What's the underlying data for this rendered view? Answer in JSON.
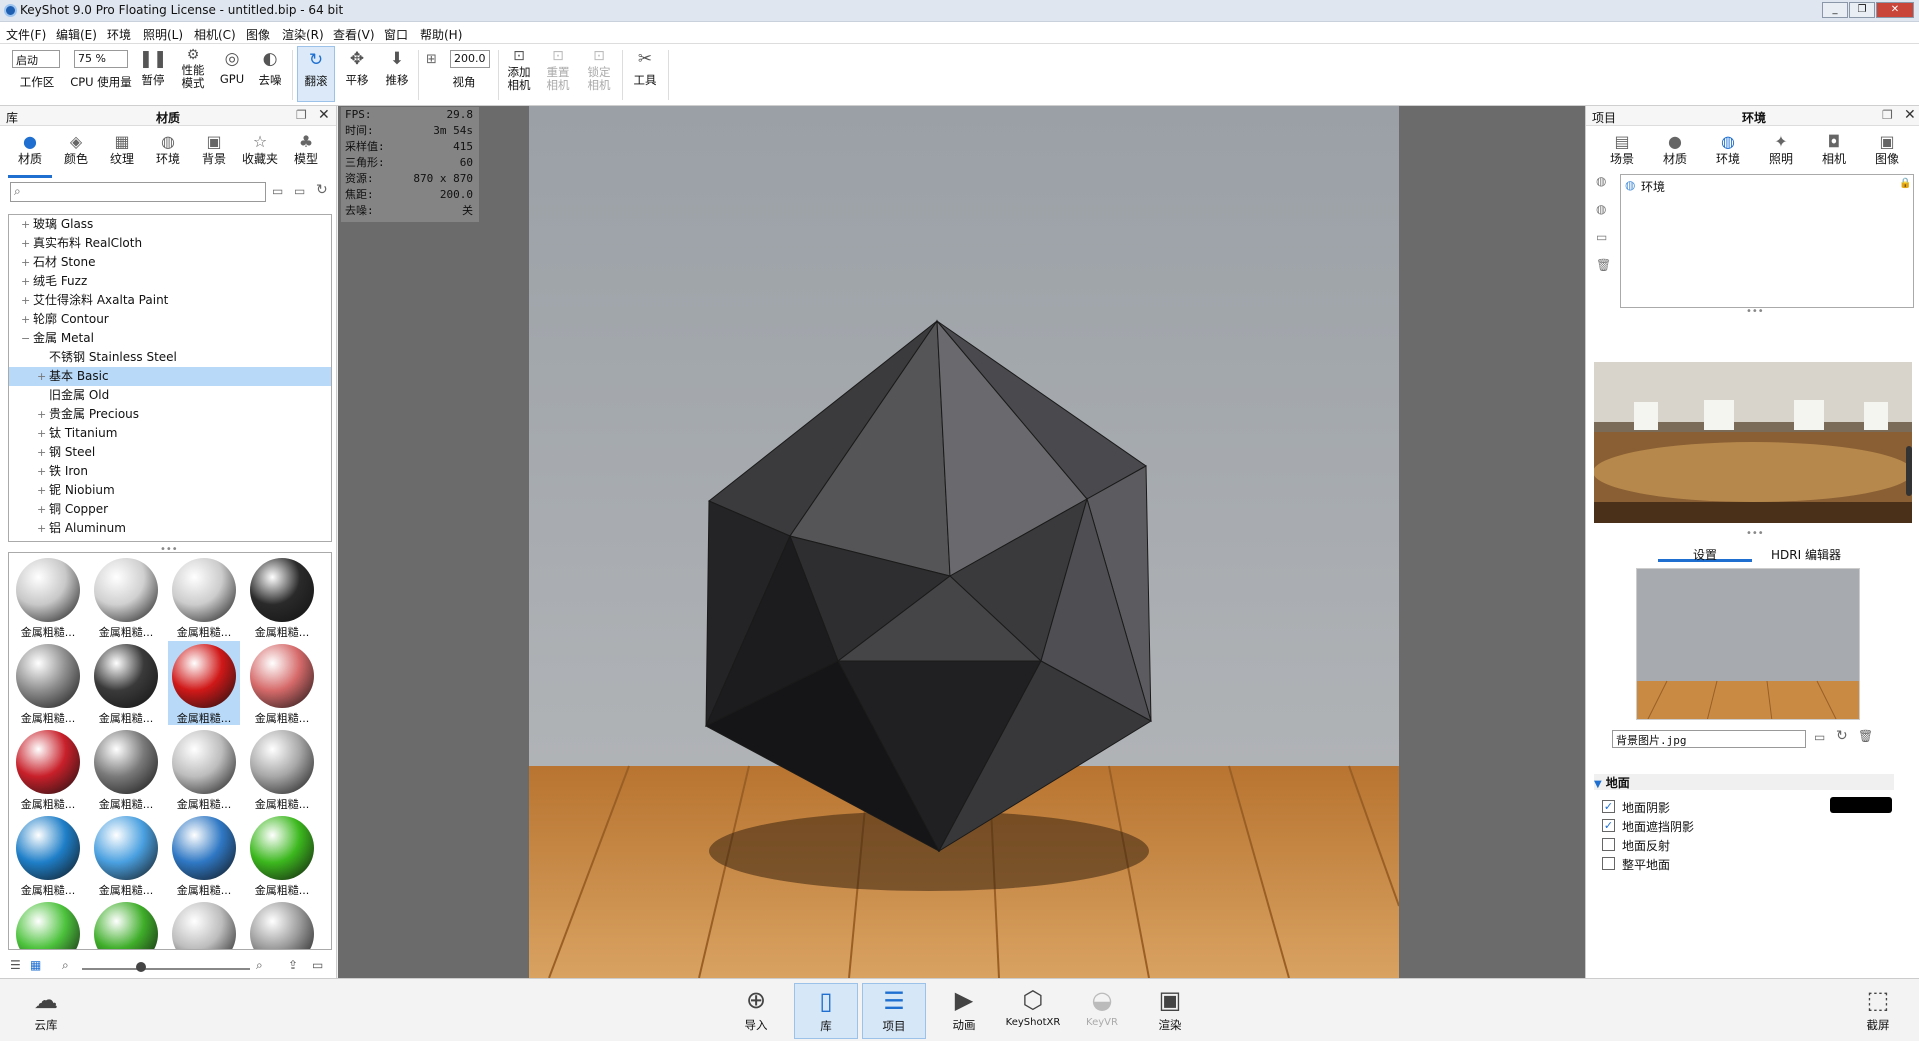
{
  "window": {
    "title": "KeyShot 9.0 Pro Floating License  - untitled.bip  - 64 bit"
  },
  "menu": [
    "文件(F)",
    "编辑(E)",
    "环境",
    "照明(L)",
    "相机(C)",
    "图像",
    "渲染(R)",
    "查看(V)",
    "窗口",
    "帮助(H)"
  ],
  "toolbar": {
    "workspace_value": "启动",
    "workspace_label": "工作区",
    "cpu_value": "75 %",
    "cpu_label": "CPU 使用量",
    "pause": "暂停",
    "perf1": "性能",
    "perf2": "模式",
    "gpu": "GPU",
    "denoise": "去噪",
    "tumble": "翻滚",
    "pan": "平移",
    "dolly": "推移",
    "fov_value": "200.0",
    "fov_label": "视角",
    "add_cam1": "添加",
    "add_cam2": "相机",
    "reset_cam1": "重置",
    "reset_cam2": "相机",
    "lock_cam1": "锁定",
    "lock_cam2": "相机",
    "tools": "工具"
  },
  "library": {
    "panel_label": "库",
    "title": "材质",
    "tabs": [
      "材质",
      "颜色",
      "纹理",
      "环境",
      "背景",
      "收藏夹",
      "模型"
    ],
    "search_placeholder": "",
    "tree": [
      {
        "exp": "+",
        "label": "玻璃 Glass",
        "indent": 0
      },
      {
        "exp": "+",
        "label": "真实布料 RealCloth",
        "indent": 0
      },
      {
        "exp": "+",
        "label": "石材 Stone",
        "indent": 0
      },
      {
        "exp": "+",
        "label": "绒毛 Fuzz",
        "indent": 0
      },
      {
        "exp": "+",
        "label": "艾仕得涂料 Axalta Paint",
        "indent": 0
      },
      {
        "exp": "+",
        "label": "轮廓 Contour",
        "indent": 0
      },
      {
        "exp": "−",
        "label": "金属 Metal",
        "indent": 0
      },
      {
        "exp": "",
        "label": "不锈钢 Stainless Steel",
        "indent": 1
      },
      {
        "exp": "+",
        "label": "基本 Basic",
        "indent": 1,
        "selected": true
      },
      {
        "exp": "",
        "label": "旧金属 Old",
        "indent": 1
      },
      {
        "exp": "+",
        "label": "贵金属 Precious",
        "indent": 1
      },
      {
        "exp": "+",
        "label": "钛 Titanium",
        "indent": 1
      },
      {
        "exp": "+",
        "label": "钢 Steel",
        "indent": 1
      },
      {
        "exp": "+",
        "label": "铁 Iron",
        "indent": 1
      },
      {
        "exp": "+",
        "label": "铌 Niobium",
        "indent": 1
      },
      {
        "exp": "+",
        "label": "铜 Copper",
        "indent": 1
      },
      {
        "exp": "+",
        "label": "铝 Aluminum",
        "indent": 1
      }
    ],
    "thumbs": [
      {
        "label": "金属粗糙...",
        "color": "#c8c8c8"
      },
      {
        "label": "金属粗糙...",
        "color": "#d0d0d0"
      },
      {
        "label": "金属粗糙...",
        "color": "#cccccc"
      },
      {
        "label": "金属粗糙...",
        "color": "#2a2a2a"
      },
      {
        "label": "金属粗糙...",
        "color": "#8f8f8f"
      },
      {
        "label": "金属粗糙...",
        "color": "#3a3a3a"
      },
      {
        "label": "金属粗糙...",
        "color": "#d01818",
        "selected": true
      },
      {
        "label": "金属粗糙...",
        "color": "#d66a6a"
      },
      {
        "label": "金属粗糙...",
        "color": "#c8202a"
      },
      {
        "label": "金属粗糙...",
        "color": "#7a7a7a"
      },
      {
        "label": "金属粗糙...",
        "color": "#bdbdbd"
      },
      {
        "label": "金属粗糙...",
        "color": "#a8a8a8"
      },
      {
        "label": "金属粗糙...",
        "color": "#1f7fc8"
      },
      {
        "label": "金属粗糙...",
        "color": "#4aa0e0"
      },
      {
        "label": "金属粗糙...",
        "color": "#2f78c4"
      },
      {
        "label": "金属粗糙...",
        "color": "#3cb81e"
      },
      {
        "label": "",
        "color": "#4cc23c"
      },
      {
        "label": "",
        "color": "#3fae2a"
      },
      {
        "label": "",
        "color": "#bdbdbd"
      },
      {
        "label": "",
        "color": "#9c9c9c"
      }
    ]
  },
  "hud": [
    {
      "k": "FPS:",
      "v": "29.8"
    },
    {
      "k": "时间:",
      "v": "3m 54s"
    },
    {
      "k": "采样值:",
      "v": "415"
    },
    {
      "k": "三角形:",
      "v": "60"
    },
    {
      "k": "资源:",
      "v": "870 x 870"
    },
    {
      "k": "焦距:",
      "v": "200.0"
    },
    {
      "k": "去噪:",
      "v": "关"
    }
  ],
  "project": {
    "panel_label": "项目",
    "title": "环境",
    "tabs": [
      "场景",
      "材质",
      "环境",
      "照明",
      "相机",
      "图像"
    ],
    "env_item": "环境",
    "subtabs": [
      "设置",
      "HDRI 编辑器"
    ],
    "bg_image": "背景图片.jpg",
    "ground_header": "地面",
    "ground_options": [
      {
        "label": "地面阴影",
        "checked": true
      },
      {
        "label": "地面遮挡阴影",
        "checked": true
      },
      {
        "label": "地面反射",
        "checked": false
      },
      {
        "label": "整平地面",
        "checked": false
      }
    ],
    "shadow_color": "#000000"
  },
  "bottom": {
    "cloud": "云库",
    "items": [
      "导入",
      "库",
      "项目",
      "动画",
      "KeyShotXR",
      "KeyVR",
      "渲染"
    ],
    "screenshot": "截屏"
  }
}
